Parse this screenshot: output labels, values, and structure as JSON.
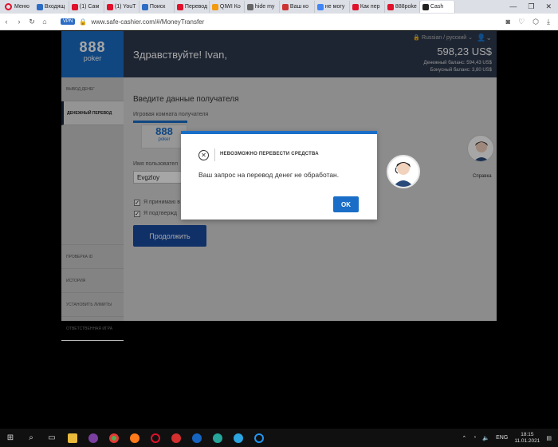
{
  "browser": {
    "menu_label": "Меню",
    "tabs": [
      {
        "label": "Входящ",
        "color": "#2d6cc4"
      },
      {
        "label": "(1) Сам",
        "color": "#e0112b"
      },
      {
        "label": "(1) YouT",
        "color": "#e0112b"
      },
      {
        "label": "Поиск",
        "color": "#2d6cc4"
      },
      {
        "label": "Перевод",
        "color": "#e0112b"
      },
      {
        "label": "QIWI Ко",
        "color": "#f29b0e"
      },
      {
        "label": "hide my",
        "color": "#666666"
      },
      {
        "label": "Ваш ко",
        "color": "#cc3333"
      },
      {
        "label": "не могу",
        "color": "#4285f4"
      },
      {
        "label": "Как пер",
        "color": "#e0112b"
      },
      {
        "label": "888poke",
        "color": "#e0112b"
      },
      {
        "label": "Cash",
        "color": "#222222"
      }
    ],
    "url": "www.safe-cashier.com/#/MoneyTransfer",
    "vpn_label": "VPN"
  },
  "header": {
    "logo_num": "888",
    "logo_sub": "poker",
    "greeting": "Здравствуйте! Ivan,",
    "language": "Russian / русский",
    "balance": "598,23 US$",
    "cash_balance": "Денежный баланс: 594,43 US$",
    "bonus_balance": "Бонусный баланс: 3,80 US$"
  },
  "sidebar": {
    "items_top": [
      "ВЫВОД ДЕНЕГ",
      "ДЕНЕЖНЫЙ ПЕРЕВОД"
    ],
    "items_bottom": [
      "ПРОВЕРКА ID",
      "ИСТОРИЯ",
      "УСТАНОВИТЬ ЛИМИТЫ",
      "ОТВЕТСТВЕННАЯ ИГРА"
    ]
  },
  "form": {
    "title": "Введите данные получателя",
    "room_label": "Игровая комната получателя",
    "username_label": "Имя пользовател",
    "username_value": "Evgzloy",
    "check1": "Я принимаю в",
    "check2": "Я подтвержд",
    "continue_label": "Продолжить",
    "help_label": "Справка"
  },
  "modal": {
    "title": "НЕВОЗМОЖНО ПЕРЕВЕСТИ СРЕДСТВА",
    "message": "Ваш запрос на перевод денег не обработан.",
    "ok_label": "OK"
  },
  "taskbar": {
    "lang": "ENG",
    "time": "18:15",
    "date": "11.01.2021"
  }
}
